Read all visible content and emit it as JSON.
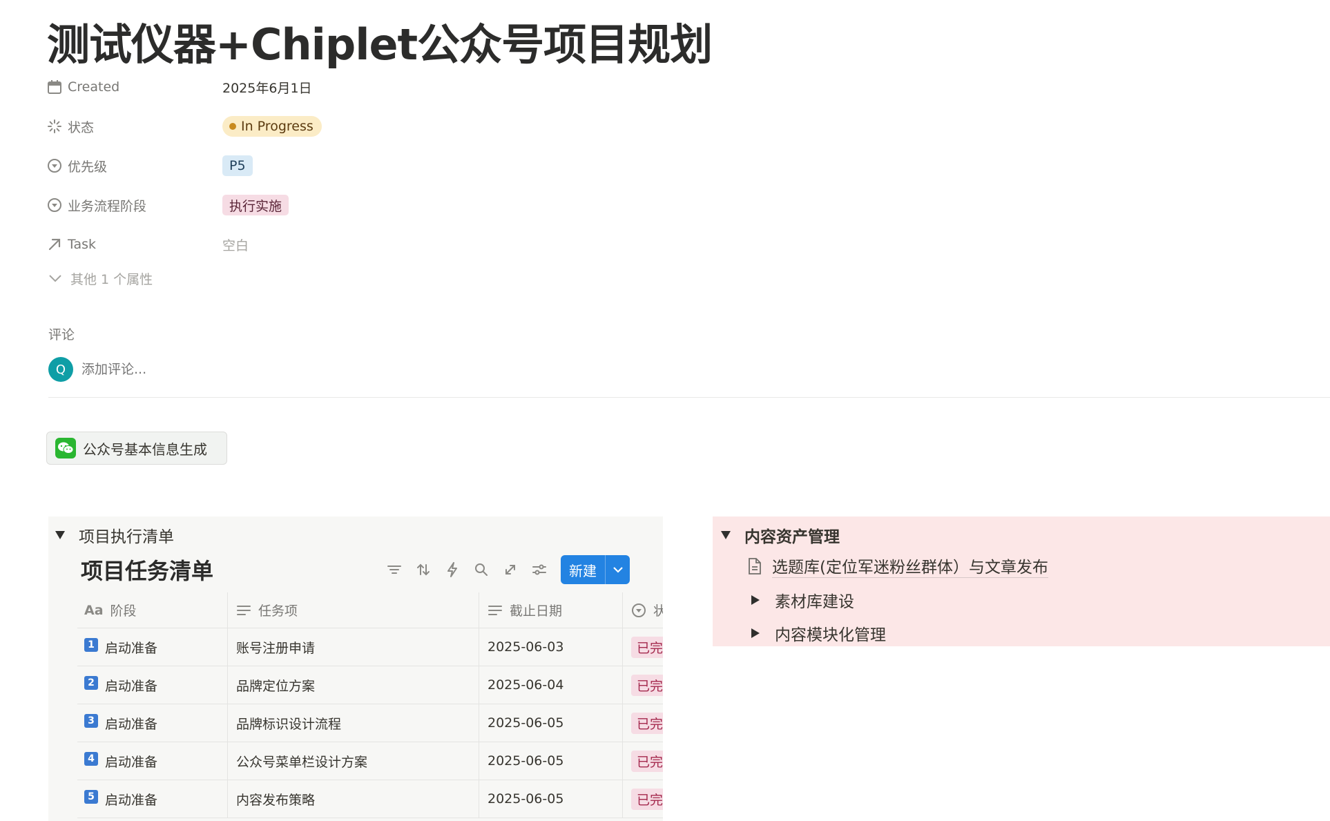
{
  "page": {
    "title": "测试仪器+Chiplet公众号项目规划"
  },
  "properties": [
    {
      "icon": "calendar-icon",
      "name": "Created",
      "value": "2025年6月1日"
    },
    {
      "icon": "status-icon",
      "name": "状态",
      "value": "In Progress",
      "color": "#fbecc6"
    },
    {
      "icon": "select-icon",
      "name": "优先级",
      "value": "P5",
      "color": "#d9eaf6"
    },
    {
      "icon": "select-icon",
      "name": "业务流程阶段",
      "value": "执行实施",
      "color": "#f6dce4"
    },
    {
      "icon": "relation-arrow-icon",
      "name": "Task",
      "value": "空白"
    }
  ],
  "more_properties": "其他 1 个属性",
  "comments": {
    "label": "评论",
    "avatar_initial": "Q",
    "placeholder": "添加评论..."
  },
  "bot_button": {
    "label": "公众号基本信息生成"
  },
  "left_toggle": {
    "title": "项目执行清单",
    "database": {
      "title": "项目任务清单",
      "new_label": "新建",
      "columns": [
        "阶段",
        "任务项",
        "截止日期",
        "状"
      ],
      "rows": [
        {
          "num": "1",
          "stage": "启动准备",
          "task": "账号注册申请",
          "due": "2025-06-03",
          "status": "已完"
        },
        {
          "num": "2",
          "stage": "启动准备",
          "task": "品牌定位方案",
          "due": "2025-06-04",
          "status": "已完"
        },
        {
          "num": "3",
          "stage": "启动准备",
          "task": "品牌标识设计流程",
          "due": "2025-06-05",
          "status": "已完"
        },
        {
          "num": "4",
          "stage": "启动准备",
          "task": "公众号菜单栏设计方案",
          "due": "2025-06-05",
          "status": "已完"
        },
        {
          "num": "5",
          "stage": "启动准备",
          "task": "内容发布策略",
          "due": "2025-06-05",
          "status": "已完"
        }
      ]
    }
  },
  "right_toggle": {
    "title": "内容资产管理",
    "items": [
      {
        "type": "page",
        "label": "选题库(定位军迷粉丝群体）与文章发布"
      },
      {
        "type": "toggle",
        "label": "素材库建设"
      },
      {
        "type": "toggle",
        "label": "内容模块化管理"
      }
    ],
    "background": "#fce7e7"
  }
}
